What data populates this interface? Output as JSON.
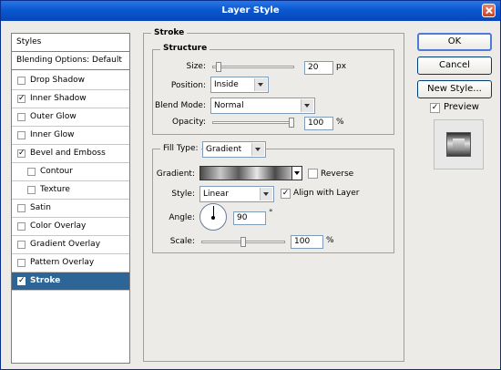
{
  "window": {
    "title": "Layer Style"
  },
  "styles_list": [
    {
      "label": "Styles",
      "type": "header"
    },
    {
      "label": "Blending Options: Default",
      "type": "header"
    },
    {
      "label": "Drop Shadow",
      "checked": false
    },
    {
      "label": "Inner Shadow",
      "checked": true
    },
    {
      "label": "Outer Glow",
      "checked": false
    },
    {
      "label": "Inner Glow",
      "checked": false
    },
    {
      "label": "Bevel and Emboss",
      "checked": true
    },
    {
      "label": "Contour",
      "checked": false,
      "indent": true
    },
    {
      "label": "Texture",
      "checked": false,
      "indent": true
    },
    {
      "label": "Satin",
      "checked": false
    },
    {
      "label": "Color Overlay",
      "checked": false
    },
    {
      "label": "Gradient Overlay",
      "checked": false
    },
    {
      "label": "Pattern Overlay",
      "checked": false
    },
    {
      "label": "Stroke",
      "checked": true,
      "selected": true
    }
  ],
  "stroke": {
    "title": "Stroke",
    "structure": {
      "title": "Structure",
      "size_label": "Size:",
      "size_value": "20",
      "size_unit": "px",
      "size_level": 0.05,
      "position_label": "Position:",
      "position_value": "Inside",
      "blend_label": "Blend Mode:",
      "blend_value": "Normal",
      "opacity_label": "Opacity:",
      "opacity_value": "100",
      "opacity_unit": "%",
      "opacity_level": 1.0
    },
    "fill": {
      "type_label": "Fill Type:",
      "type_value": "Gradient",
      "gradient_label": "Gradient:",
      "reverse_label": "Reverse",
      "reverse_checked": false,
      "style_label": "Style:",
      "style_value": "Linear",
      "align_label": "Align with Layer",
      "align_checked": true,
      "angle_label": "Angle:",
      "angle_value": "90",
      "angle_unit": "°",
      "scale_label": "Scale:",
      "scale_value": "100",
      "scale_unit": "%",
      "scale_level": 0.5
    }
  },
  "buttons": {
    "ok": "OK",
    "cancel": "Cancel",
    "new_style": "New Style...",
    "preview_label": "Preview",
    "preview_checked": true
  },
  "colors": {
    "titlebar": "#0a58d0",
    "selection": "#2d6596",
    "dialog_bg": "#ecebe8"
  },
  "icons": {
    "close": "close-icon",
    "angle": "angle-dial-icon"
  }
}
